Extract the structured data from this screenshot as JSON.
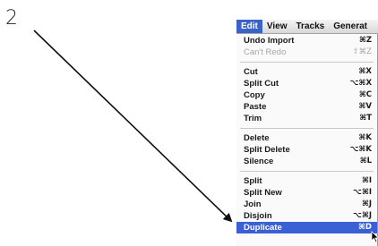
{
  "step_number": "2",
  "menubar": {
    "items": [
      {
        "label": "Edit",
        "active": true
      },
      {
        "label": "View"
      },
      {
        "label": "Tracks"
      },
      {
        "label": "Generat"
      }
    ]
  },
  "edit_menu": {
    "groups": [
      [
        {
          "label": "Undo Import",
          "shortcut": "⌘Z"
        },
        {
          "label": "Can't Redo",
          "shortcut": "⇧⌘Z",
          "disabled": true
        }
      ],
      [
        {
          "label": "Cut",
          "shortcut": "⌘X"
        },
        {
          "label": "Split Cut",
          "shortcut": "⌥⌘X"
        },
        {
          "label": "Copy",
          "shortcut": "⌘C"
        },
        {
          "label": "Paste",
          "shortcut": "⌘V"
        },
        {
          "label": "Trim",
          "shortcut": "⌘T"
        }
      ],
      [
        {
          "label": "Delete",
          "shortcut": "⌘K"
        },
        {
          "label": "Split Delete",
          "shortcut": "⌥⌘K"
        },
        {
          "label": "Silence",
          "shortcut": "⌘L"
        }
      ],
      [
        {
          "label": "Split",
          "shortcut": "⌘I"
        },
        {
          "label": "Split New",
          "shortcut": "⌥⌘I"
        },
        {
          "label": "Join",
          "shortcut": "⌘J"
        },
        {
          "label": "Disjoin",
          "shortcut": "⌥⌘J"
        },
        {
          "label": "Duplicate",
          "shortcut": "⌘D",
          "selected": true
        }
      ]
    ]
  },
  "colors": {
    "highlight": "#3b5fd4",
    "arrow": "#111111"
  },
  "icons": {
    "cursor": "mouse-pointer-icon",
    "arrow": "annotation-arrow"
  }
}
